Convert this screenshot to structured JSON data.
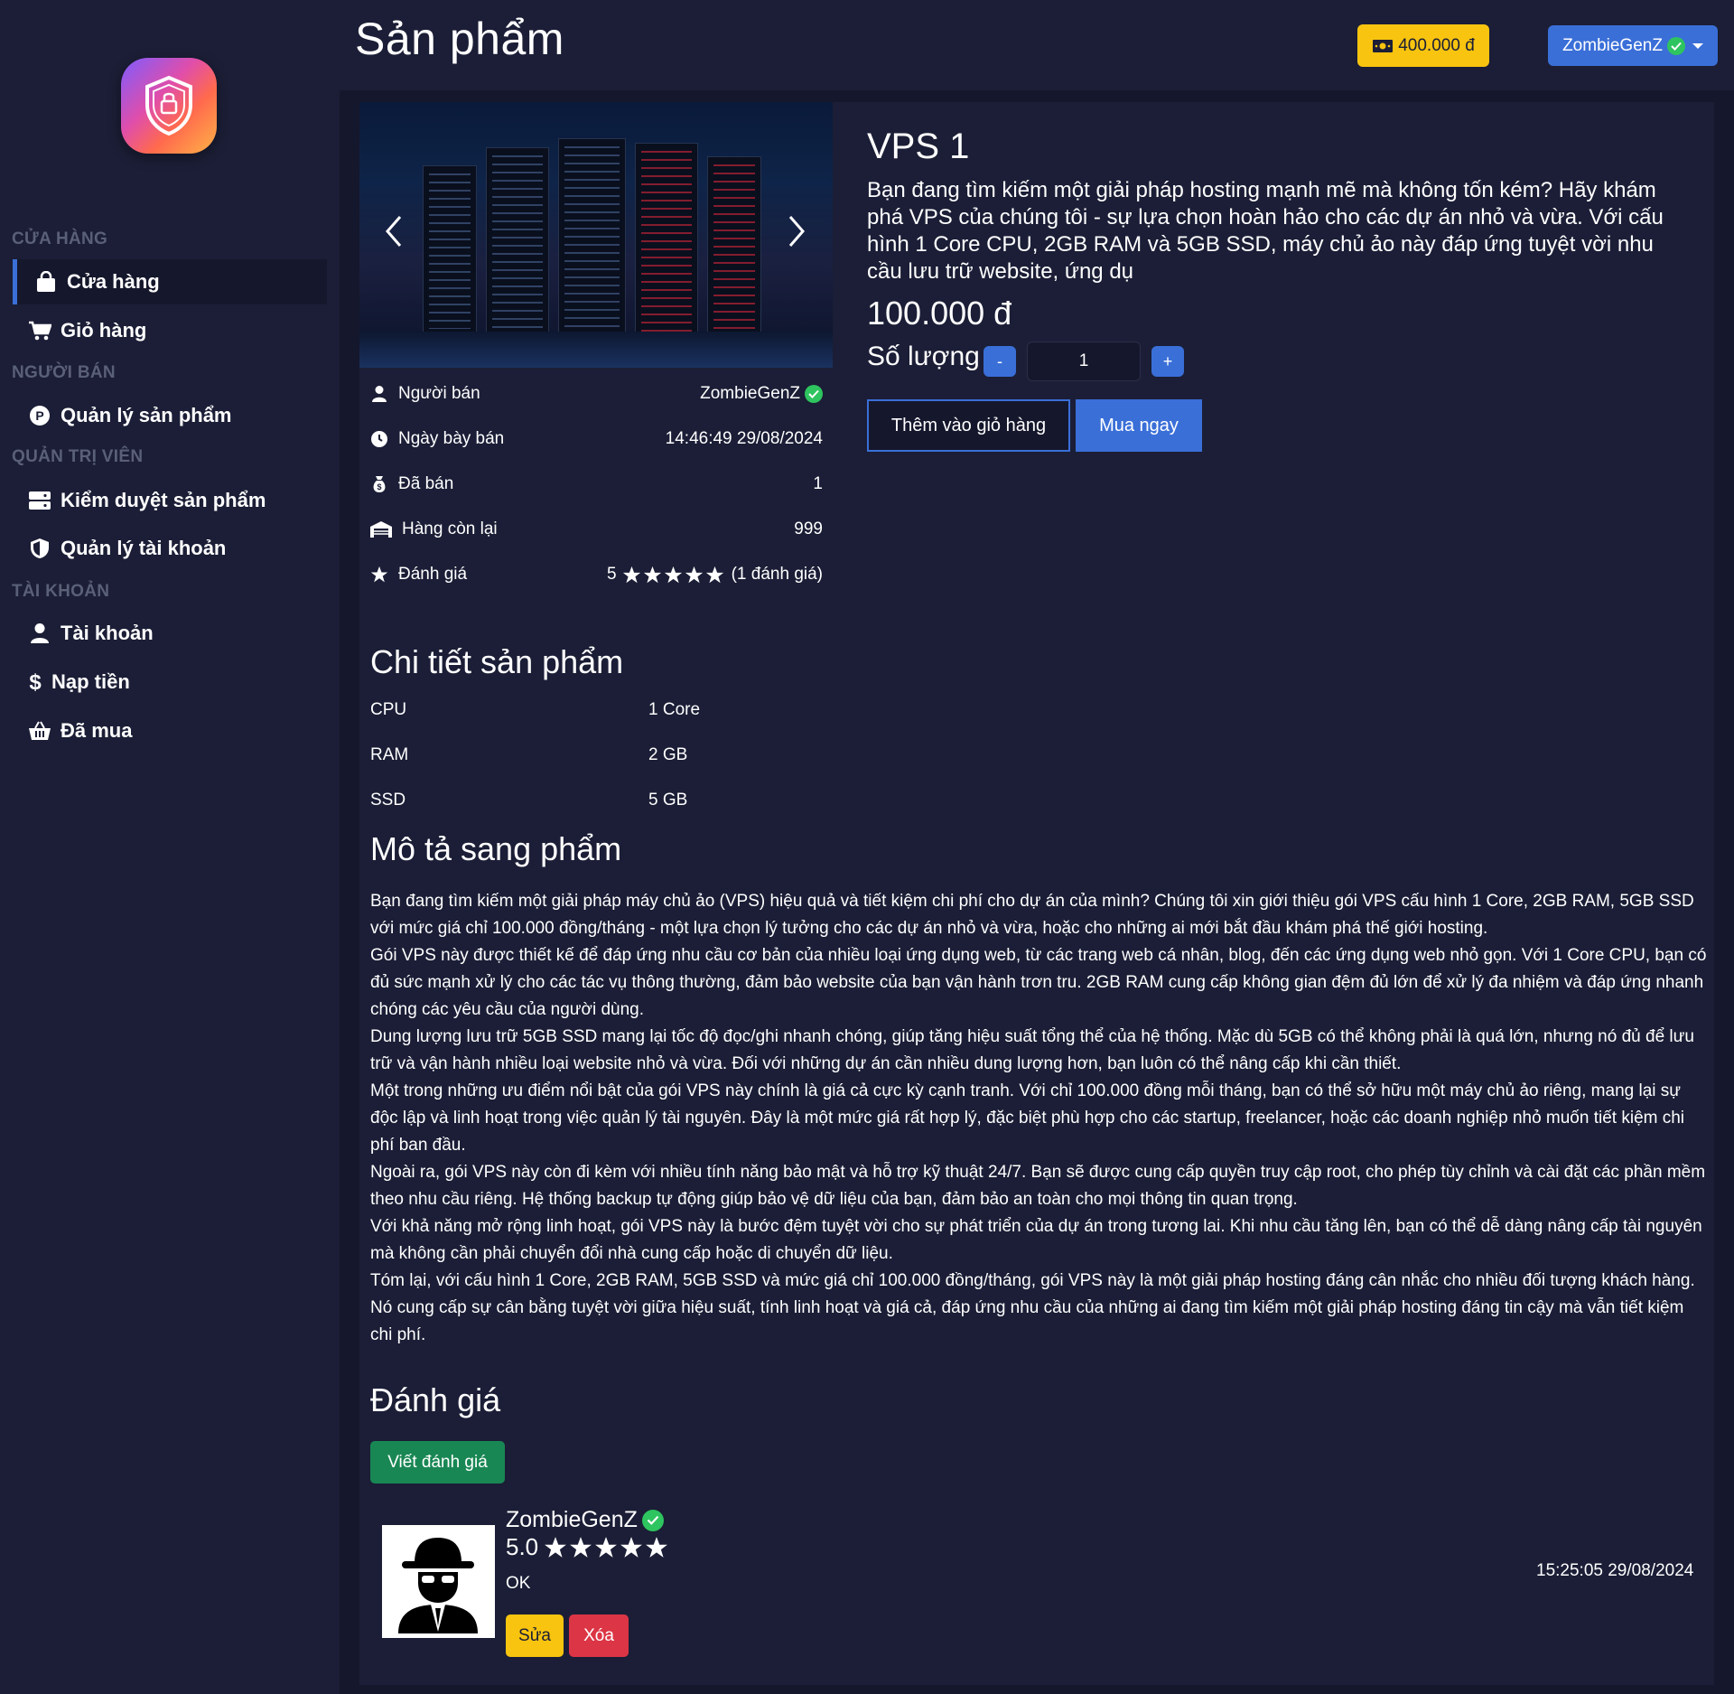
{
  "header": {
    "title": "Sản phẩm",
    "balance": "400.000 đ",
    "username": "ZombieGenZ"
  },
  "sidebar": {
    "sections": [
      {
        "title": "CỬA HÀNG",
        "items": [
          {
            "label": "Cửa hàng",
            "icon": "bag-icon",
            "active": true
          },
          {
            "label": "Giỏ hàng",
            "icon": "cart-icon"
          }
        ]
      },
      {
        "title": "NGƯỜI BÁN",
        "items": [
          {
            "label": "Quản lý sản phẩm",
            "icon": "product-p-icon"
          }
        ]
      },
      {
        "title": "QUẢN TRỊ VIÊN",
        "items": [
          {
            "label": "Kiểm duyệt sản phẩm",
            "icon": "server-icon"
          },
          {
            "label": "Quản lý tài khoản",
            "icon": "shield-icon"
          }
        ]
      },
      {
        "title": "TÀI KHOẢN",
        "items": [
          {
            "label": "Tài khoản",
            "icon": "user-icon"
          },
          {
            "label": "Nạp tiền",
            "icon": "dollar-icon"
          },
          {
            "label": "Đã mua",
            "icon": "basket-icon"
          }
        ]
      }
    ]
  },
  "product": {
    "name": "VPS 1",
    "short_description": "Bạn đang tìm kiếm một giải pháp hosting mạnh mẽ mà không tốn kém? Hãy khám phá VPS của chúng tôi - sự lựa chọn hoàn hảo cho các dự án nhỏ và vừa. Với cấu hình 1 Core CPU, 2GB RAM và 5GB SSD, máy chủ ảo này đáp ứng tuyệt vời nhu cầu lưu trữ website, ứng dụ",
    "price": "100.000 đ",
    "quantity_label": "Số lượng",
    "quantity": "1",
    "minus": "-",
    "plus": "+",
    "add_to_cart": "Thêm vào giỏ hàng",
    "buy_now": "Mua ngay",
    "info": [
      {
        "label": "Người bán",
        "value": "ZombieGenZ",
        "icon": "user-icon"
      },
      {
        "label": "Ngày bày bán",
        "value": "14:46:49 29/08/2024",
        "icon": "clock-icon"
      },
      {
        "label": "Đã bán",
        "value": "1",
        "icon": "money-bag-icon"
      },
      {
        "label": "Hàng còn lại",
        "value": "999",
        "icon": "warehouse-icon"
      },
      {
        "label": "Đánh giá",
        "value": "5",
        "extra": "(1 đánh giá)",
        "icon": "star-icon",
        "stars": 5
      }
    ]
  },
  "details": {
    "title": "Chi tiết sản phẩm",
    "specs": [
      {
        "name": "CPU",
        "value": "1 Core"
      },
      {
        "name": "RAM",
        "value": "2 GB"
      },
      {
        "name": "SSD",
        "value": "5 GB"
      }
    ]
  },
  "description": {
    "title": "Mô tả sang phẩm",
    "paragraphs": [
      "Bạn đang tìm kiếm một giải pháp máy chủ ảo (VPS) hiệu quả và tiết kiệm chi phí cho dự án của mình? Chúng tôi xin giới thiệu gói VPS cấu hình 1 Core, 2GB RAM, 5GB SSD với mức giá chỉ 100.000 đồng/tháng - một lựa chọn lý tưởng cho các dự án nhỏ và vừa, hoặc cho những ai mới bắt đầu khám phá thế giới hosting.",
      "Gói VPS này được thiết kế để đáp ứng nhu cầu cơ bản của nhiều loại ứng dụng web, từ các trang web cá nhân, blog, đến các ứng dụng web nhỏ gọn. Với 1 Core CPU, bạn có đủ sức mạnh xử lý cho các tác vụ thông thường, đảm bảo website của bạn vận hành trơn tru. 2GB RAM cung cấp không gian đệm đủ lớn để xử lý đa nhiệm và đáp ứng nhanh chóng các yêu cầu của người dùng.",
      "Dung lượng lưu trữ 5GB SSD mang lại tốc độ đọc/ghi nhanh chóng, giúp tăng hiệu suất tổng thể của hệ thống. Mặc dù 5GB có thể không phải là quá lớn, nhưng nó đủ để lưu trữ và vận hành nhiều loại website nhỏ và vừa. Đối với những dự án cần nhiều dung lượng hơn, bạn luôn có thể nâng cấp khi cần thiết.",
      "Một trong những ưu điểm nổi bật của gói VPS này chính là giá cả cực kỳ cạnh tranh. Với chỉ 100.000 đồng mỗi tháng, bạn có thể sở hữu một máy chủ ảo riêng, mang lại sự độc lập và linh hoạt trong việc quản lý tài nguyên. Đây là một mức giá rất hợp lý, đặc biệt phù hợp cho các startup, freelancer, hoặc các doanh nghiệp nhỏ muốn tiết kiệm chi phí ban đầu.",
      "Ngoài ra, gói VPS này còn đi kèm với nhiều tính năng bảo mật và hỗ trợ kỹ thuật 24/7. Bạn sẽ được cung cấp quyền truy cập root, cho phép tùy chỉnh và cài đặt các phần mềm theo nhu cầu riêng. Hệ thống backup tự động giúp bảo vệ dữ liệu của bạn, đảm bảo an toàn cho mọi thông tin quan trọng.",
      "Với khả năng mở rộng linh hoạt, gói VPS này là bước đệm tuyệt vời cho sự phát triển của dự án trong tương lai. Khi nhu cầu tăng lên, bạn có thể dễ dàng nâng cấp tài nguyên mà không cần phải chuyển đổi nhà cung cấp hoặc di chuyển dữ liệu.",
      "Tóm lại, với cấu hình 1 Core, 2GB RAM, 5GB SSD và mức giá chỉ 100.000 đồng/tháng, gói VPS này là một giải pháp hosting đáng cân nhắc cho nhiều đối tượng khách hàng. Nó cung cấp sự cân bằng tuyệt vời giữa hiệu suất, tính linh hoạt và giá cả, đáp ứng nhu cầu của những ai đang tìm kiếm một giải pháp hosting đáng tin cậy mà vẫn tiết kiệm chi phí."
    ]
  },
  "reviews": {
    "title": "Đánh giá",
    "write_button": "Viết đánh giá",
    "items": [
      {
        "author": "ZombieGenZ",
        "score": "5.0",
        "stars": 5,
        "text": "OK",
        "date": "15:25:05 29/08/2024",
        "edit": "Sửa",
        "delete": "Xóa"
      }
    ]
  },
  "colors": {
    "background": "#1b1e36",
    "panel": "#15172c",
    "accent": "#3a6fd8",
    "balance": "#f8c40f",
    "success": "#198754",
    "danger": "#dc3545",
    "verified": "#2ec45f"
  }
}
